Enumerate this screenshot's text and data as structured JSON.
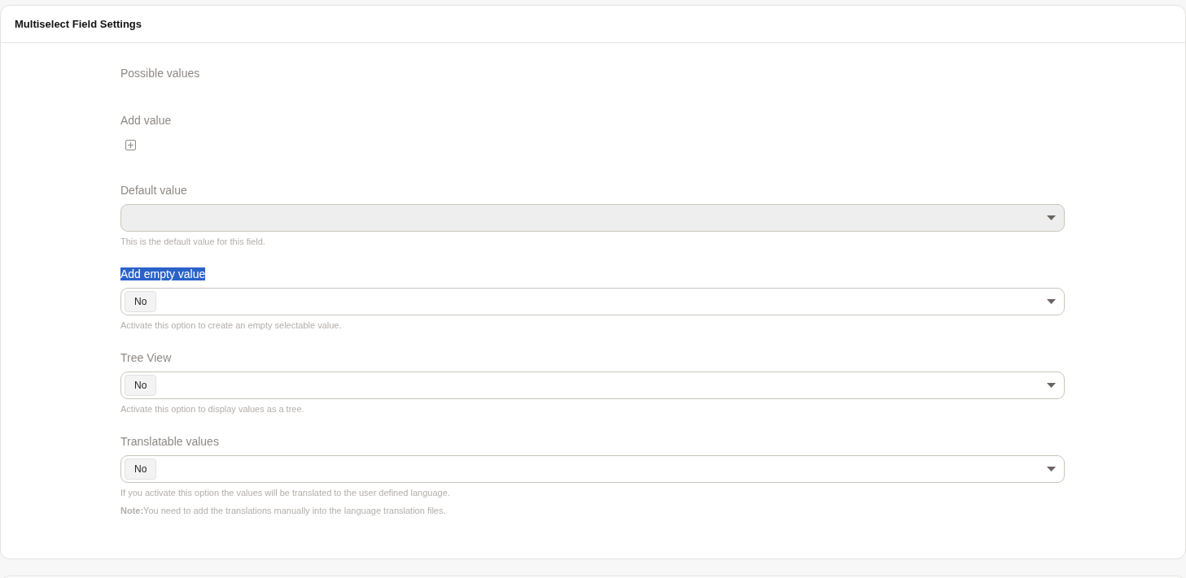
{
  "panel": {
    "title": "Multiselect Field Settings"
  },
  "fields": [
    {
      "kind": "heading",
      "label": "Possible values",
      "highlighted": false
    },
    {
      "kind": "add",
      "label": "Add value",
      "highlighted": false
    },
    {
      "kind": "select",
      "label": "Default value",
      "highlighted": false,
      "disabled": true,
      "help": [
        "This is the default value for this field."
      ]
    },
    {
      "kind": "select",
      "label": "Add empty value",
      "highlighted": true,
      "disabled": false,
      "value": "No",
      "help": [
        "Activate this option to create an empty selectable value."
      ]
    },
    {
      "kind": "select",
      "label": "Tree View",
      "highlighted": false,
      "disabled": false,
      "value": "No",
      "help": [
        "Activate this option to display values as a tree."
      ]
    },
    {
      "kind": "select",
      "label": "Translatable values",
      "highlighted": false,
      "disabled": false,
      "value": "No",
      "help": [
        "If you activate this option the values will be translated to the user defined language.",
        "**Note:**You need to add the translations manually into the language translation files."
      ]
    }
  ]
}
